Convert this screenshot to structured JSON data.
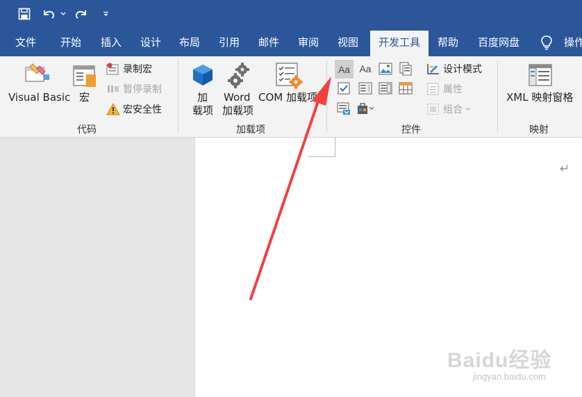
{
  "colors": {
    "ribbon_blue": "#2b579a",
    "ribbon_bg": "#f3f3f3",
    "doc_bg": "#e6e6e6",
    "arrow": "#f0413e"
  },
  "quick_access": {
    "icons": [
      "save-icon",
      "undo-icon",
      "undo-dropdown-icon",
      "redo-icon",
      "customize-qat-icon"
    ]
  },
  "tabs": [
    {
      "label": "文件"
    },
    {
      "label": "开始"
    },
    {
      "label": "插入"
    },
    {
      "label": "设计"
    },
    {
      "label": "布局"
    },
    {
      "label": "引用"
    },
    {
      "label": "邮件"
    },
    {
      "label": "审阅"
    },
    {
      "label": "视图"
    },
    {
      "label": "开发工具",
      "active": true
    },
    {
      "label": "帮助"
    },
    {
      "label": "百度网盘"
    },
    {
      "label": "操作"
    }
  ],
  "tell_me_icon": "lightbulb-icon",
  "groups": {
    "code": {
      "label": "代码",
      "visual_basic": "Visual Basic",
      "macros": "宏",
      "record_macro": "录制宏",
      "pause_recording": "暂停录制",
      "macro_security": "宏安全性"
    },
    "addins": {
      "label": "加载项",
      "addins_line1": "加",
      "addins_line2": "载项",
      "word_addins_line1": "Word",
      "word_addins_line2": "加载项",
      "com_addins": "COM 加载项"
    },
    "controls": {
      "label": "控件",
      "design_mode": "设计模式",
      "properties": "属性",
      "group": "组合",
      "rich_text_label": "Aa",
      "plain_text_label": "Aa"
    },
    "mapping": {
      "label": "映射",
      "xml_mapping": "XML 映射窗格"
    }
  },
  "document": {
    "paragraph_mark": "↵"
  },
  "watermark": {
    "logo": "Baidu经验",
    "url": "jingyan.baidu.com"
  }
}
